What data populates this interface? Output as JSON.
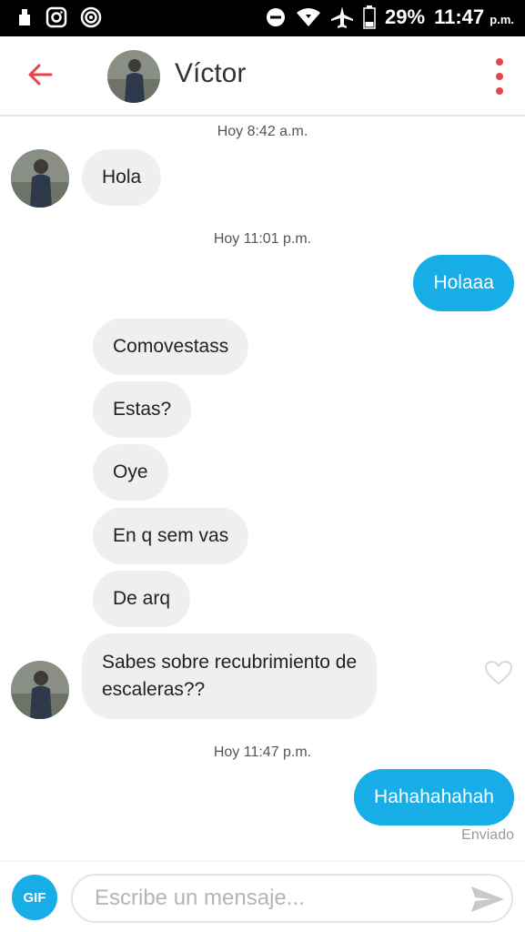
{
  "status_bar": {
    "battery_percent": "29%",
    "time": "11:47",
    "time_suffix": "p.m.",
    "left_icons": [
      "notification-icon",
      "instagram-icon",
      "target-icon"
    ],
    "right_icons": [
      "do-not-disturb-icon",
      "wifi-icon",
      "airplane-icon",
      "battery-icon"
    ]
  },
  "header": {
    "contact_name": "Víctor",
    "back_icon": "arrow-left-icon",
    "menu_icon": "more-vertical-icon",
    "accent_color": "#e8414b"
  },
  "chat": {
    "timestamps": [
      "Hoy 8:42 a.m.",
      "Hoy 11:01 p.m.",
      "Hoy 11:47 p.m."
    ],
    "messages": [
      {
        "direction": "in",
        "text": "Hola"
      },
      {
        "direction": "out",
        "text": "Holaaa"
      },
      {
        "direction": "in",
        "text": "Comovestass"
      },
      {
        "direction": "in",
        "text": "Estas?"
      },
      {
        "direction": "in",
        "text": "Oye"
      },
      {
        "direction": "in",
        "text": "En q sem vas"
      },
      {
        "direction": "in",
        "text": "De arq"
      },
      {
        "direction": "in",
        "text_line1": "Sabes sobre recubrimiento de",
        "text_line2": "escaleras??"
      },
      {
        "direction": "out",
        "text": "Hahahahahah"
      }
    ],
    "sent_status": "Enviado",
    "outgoing_color": "#17aee8",
    "incoming_color": "#efefef"
  },
  "composer": {
    "gif_label": "GIF",
    "placeholder": "Escribe un mensaje...",
    "send_icon": "send-icon"
  }
}
